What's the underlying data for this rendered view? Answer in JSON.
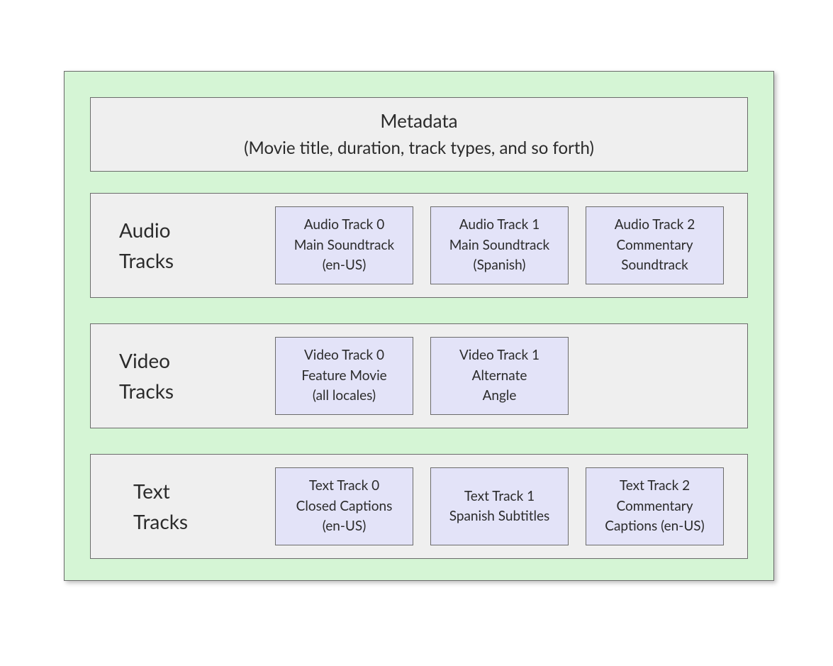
{
  "metadata": {
    "line1": "Metadata",
    "line2": "(Movie title, duration, track types, and so forth)"
  },
  "sections": {
    "audio": {
      "label_word1": "Audio",
      "label_word2": "Tracks",
      "tracks": [
        {
          "l1": "Audio Track 0",
          "l2": "Main Soundtrack",
          "l3": "(en-US)"
        },
        {
          "l1": "Audio Track 1",
          "l2": "Main Soundtrack",
          "l3": "(Spanish)"
        },
        {
          "l1": "Audio Track 2",
          "l2": "Commentary",
          "l3": "Soundtrack"
        }
      ]
    },
    "video": {
      "label_word1": "Video",
      "label_word2": "Tracks",
      "tracks": [
        {
          "l1": "Video Track 0",
          "l2": "Feature Movie",
          "l3": "(all locales)"
        },
        {
          "l1": "Video Track 1",
          "l2": "Alternate",
          "l3": "Angle"
        }
      ]
    },
    "text": {
      "label_word1": "Text",
      "label_word2": "Tracks",
      "tracks": [
        {
          "l1": "Text Track  0",
          "l2": "Closed Captions",
          "l3": "(en-US)"
        },
        {
          "l1": "Text Track  1",
          "l2": "Spanish Subtitles",
          "l3": ""
        },
        {
          "l1": "Text Track  2",
          "l2": "Commentary",
          "l3": "Captions (en-US)"
        }
      ]
    }
  }
}
